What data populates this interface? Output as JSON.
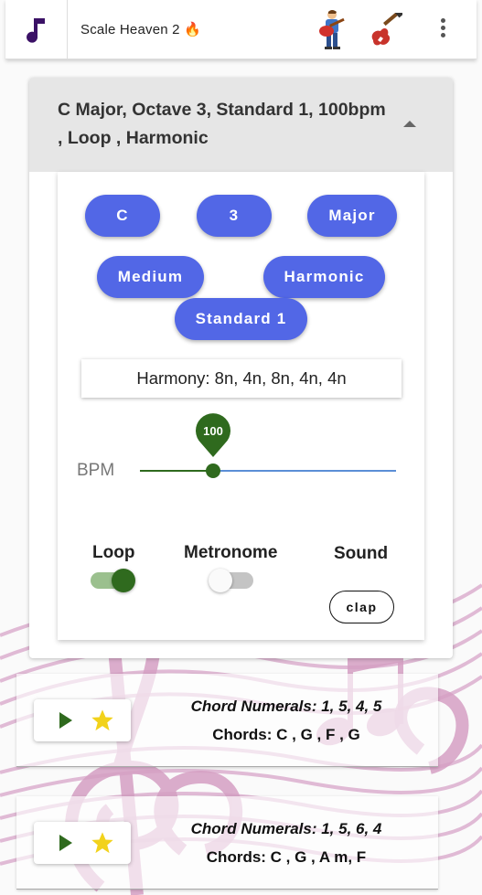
{
  "app": {
    "title": "Scale Heaven 2",
    "title_emoji": "🔥"
  },
  "icons": {
    "logo": "music-note-icon",
    "player": "guitar-player-icon",
    "guitar": "electric-guitar-icon",
    "menu": "more-vert-icon"
  },
  "panel": {
    "summary": "C Major, Octave 3, Standard 1, 100bpm , Loop , Harmonic",
    "pills": {
      "key": "C",
      "octave": "3",
      "scale": "Major",
      "speed": "Medium",
      "mode": "Harmonic",
      "tuning": "Standard 1"
    },
    "harmony": "Harmony: 8n, 4n, 8n, 4n, 4n",
    "bpm": {
      "label": "BPM",
      "value": "100",
      "fraction": 0.286
    },
    "options": {
      "loop_label": "Loop",
      "loop_on": true,
      "metronome_label": "Metronome",
      "metronome_on": false,
      "sound_label": "Sound",
      "sound_value": "clap"
    }
  },
  "progressions": [
    {
      "numerals": "Chord Numerals: 1, 5, 4, 5",
      "chords": "Chords: C , G , F , G"
    },
    {
      "numerals": "Chord Numerals: 1, 5, 6, 4",
      "chords": "Chords: C , G , A m, F"
    }
  ],
  "colors": {
    "accent": "#5267e6",
    "slider_active": "#2f6a1e",
    "slider_track": "#5b8ed6",
    "star": "#f2d21b",
    "logo": "#3b1166",
    "deco": "#d9a6c9"
  }
}
